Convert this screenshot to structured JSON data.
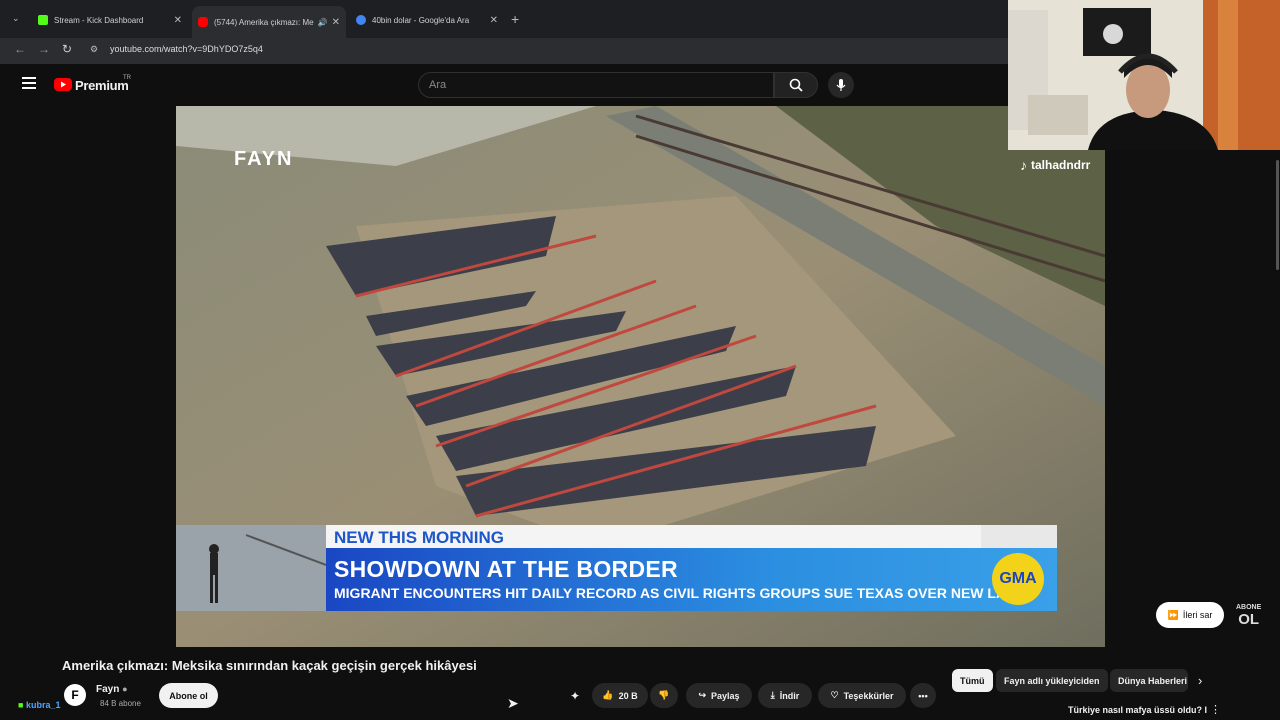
{
  "browser": {
    "tabs": [
      {
        "title": "Stream - Kick Dashboard",
        "fav_color": "#53fc18"
      },
      {
        "title": "(5744) Amerika çıkmazı: Me",
        "fav_color": "#ff0000"
      },
      {
        "title": "40bin dolar - Google'da Ara",
        "fav_color": "#4285f4"
      }
    ],
    "url": "youtube.com/watch?v=9DhYDO7z5q4"
  },
  "youtube": {
    "logo": "Premium",
    "region": "TR",
    "search_placeholder": "Ara"
  },
  "video": {
    "brand_overlay": "FAYN",
    "lower_third": {
      "top": "NEW THIS MORNING",
      "headline": "SHOWDOWN AT THE BORDER",
      "sub": "MIGRANT ENCOUNTERS HIT DAILY RECORD AS CIVIL RIGHTS GROUPS SUE TEXAS OVER NEW LAW",
      "logo": "GMA"
    },
    "skip_label": "İleri sar",
    "abone_small": "ABONE",
    "abone_big": "OL"
  },
  "meta": {
    "title": "Amerika çıkmazı: Meksika sınırından kaçak geçişin gerçek hikâyesi",
    "channel": "Fayn",
    "avatar_letter": "F",
    "subscribers": "84 B abone",
    "subscribe_label": "Abone ol",
    "likes": "20 B",
    "share_label": "Paylaş",
    "download_label": "İndir",
    "thanks_label": "Teşekkürler"
  },
  "chips": [
    "Tümü",
    "Fayn adlı yükleyiciden",
    "Dünya Haberleri"
  ],
  "recommendation_title": "Türkiye nasıl mafya üssü oldu? I",
  "stream": {
    "cam_name": "talhadndrr",
    "chat_user": "kubra_1"
  }
}
